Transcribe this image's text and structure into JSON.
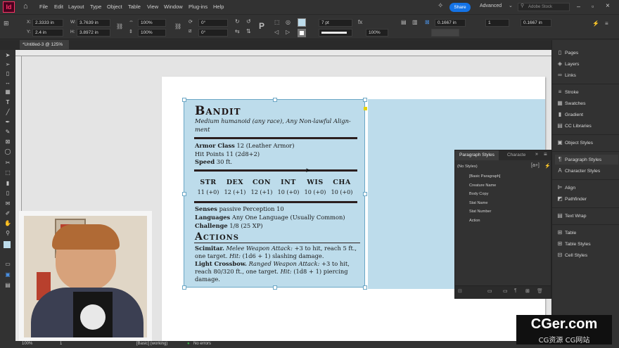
{
  "app": {
    "logo": "Id"
  },
  "menu": [
    "File",
    "Edit",
    "Layout",
    "Type",
    "Object",
    "Table",
    "View",
    "Window",
    "Plug-ins",
    "Help"
  ],
  "header": {
    "share_label": "Share",
    "workspace": "Advanced",
    "search_placeholder": "Adobe Stock"
  },
  "control": {
    "x": "2.3333 in",
    "y": "2.4 in",
    "w": "3.7639 in",
    "h": "3.8972 in",
    "scale_x": "100%",
    "scale_y": "100%",
    "rotate": "0°",
    "shear": "0°",
    "stroke_weight": "7 pt",
    "opacity": "100%",
    "inset": "0.1667 in",
    "inset2": "0.1667 in",
    "columns": "1",
    "label_x": "X:",
    "label_y": "Y:",
    "label_w": "W:",
    "label_h": "H:"
  },
  "document": {
    "tab": "*Untitled-3 @ 125%",
    "close": "×"
  },
  "statblock": {
    "name": "Bandit",
    "subtitle": "Medium humanoid (any race), Any Non-lawful Align-",
    "subtitle2": "ment",
    "ac_label": "Armor Class",
    "ac_value": "12 (Leather Armor)",
    "hp_label": "Hit Points",
    "hp_value": "11 (2d8+2)",
    "speed_label": "Speed",
    "speed_value": "30 ft.",
    "abilities": [
      {
        "name": "STR",
        "value": "11 (+0)"
      },
      {
        "name": "DEX",
        "value": "12 (+1)"
      },
      {
        "name": "CON",
        "value": "12 (+1)"
      },
      {
        "name": "INT",
        "value": "10 (+0)"
      },
      {
        "name": "WIS",
        "value": "10 (+0)"
      },
      {
        "name": "CHA",
        "value": "10 (+0)"
      }
    ],
    "senses_label": "Senses",
    "senses_value": "passive Perception 10",
    "lang_label": "Languages",
    "lang_value": "Any One Language (Usually Common)",
    "cr_label": "Challenge",
    "cr_value": "1/8 (25 XP)",
    "actions_title": "Actions",
    "scimitar_label": "Scimitar.",
    "scimitar_type": "Melee Weapon Attack:",
    "scimitar_rest": "+3 to hit, reach 5 ft.,",
    "scimitar_line2a": "one target.",
    "scimitar_hit": "Hit:",
    "scimitar_line2b": "(1d6 + 1) slashing damage.",
    "crossbow_label": "Light Crossbow.",
    "crossbow_type": "Ranged Weapon Attack:",
    "crossbow_rest": "+3 to hit,",
    "crossbow_line2a": "reach 80/320 ft., one target.",
    "crossbow_hit": "Hit:",
    "crossbow_line2b": "(1d8 + 1) piercing",
    "crossbow_line3": "damage."
  },
  "panels": {
    "dock": [
      "Pages",
      "Layers",
      "Links",
      "Stroke",
      "Swatches",
      "Gradient",
      "CC Libraries",
      "Object Styles",
      "Paragraph Styles",
      "Character Styles",
      "Align",
      "Pathfinder",
      "Text Wrap",
      "Table",
      "Table Styles",
      "Cell Styles"
    ],
    "paragraph_styles": {
      "tab_active": "Paragraph Styles",
      "tab_other": "Characte",
      "current": "(No Styles)",
      "items": [
        "[Basic Paragraph]",
        "Creature Name",
        "Body Copy",
        "Stat Name",
        "Stat Number",
        "Action"
      ]
    }
  },
  "status": {
    "zoom": "100%",
    "page": "1",
    "style": "[Basic] (working)",
    "errors": "No errors"
  },
  "watermark": {
    "line1": "CGer.com",
    "line2": "CG资源 CG网站"
  },
  "colors": {
    "accent": "#1473e6",
    "id_brand": "#ff3366",
    "frame_fill": "#bddceb"
  }
}
